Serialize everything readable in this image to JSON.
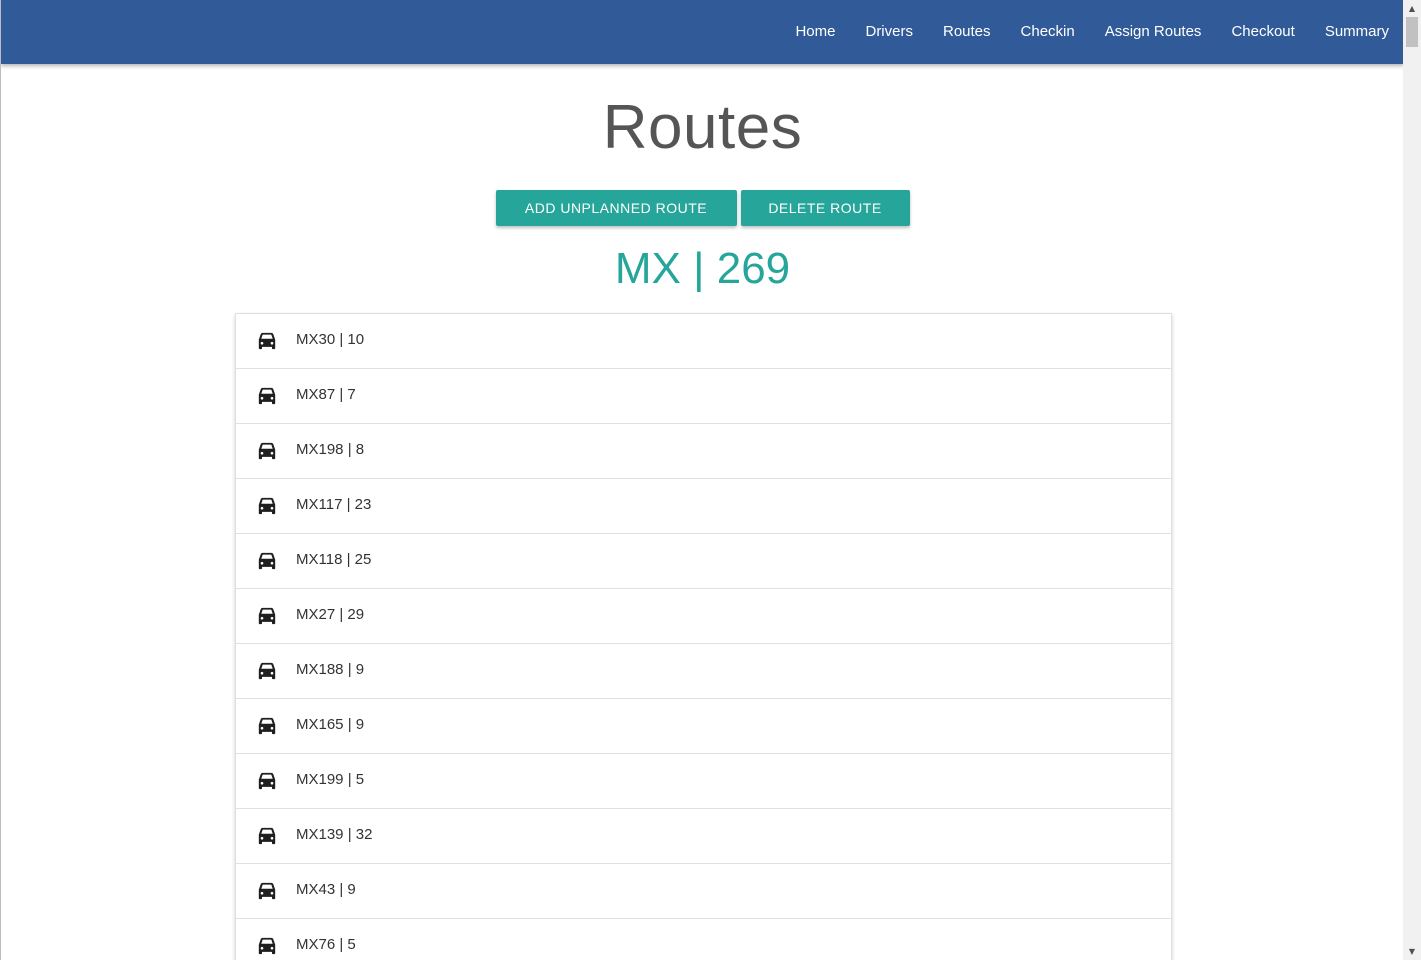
{
  "nav": {
    "items": [
      {
        "label": "Home"
      },
      {
        "label": "Drivers"
      },
      {
        "label": "Routes"
      },
      {
        "label": "Checkin"
      },
      {
        "label": "Assign Routes"
      },
      {
        "label": "Checkout"
      },
      {
        "label": "Summary"
      }
    ]
  },
  "page": {
    "title": "Routes",
    "summary": "MX | 269"
  },
  "actions": {
    "add_label": "ADD UNPLANNED ROUTE",
    "delete_label": "DELETE ROUTE"
  },
  "routes": [
    {
      "label": "MX30 | 10",
      "icon": "car-icon"
    },
    {
      "label": "MX87 | 7",
      "icon": "car-icon"
    },
    {
      "label": "MX198 | 8",
      "icon": "car-icon"
    },
    {
      "label": "MX117 | 23",
      "icon": "car-icon"
    },
    {
      "label": "MX118 | 25",
      "icon": "car-icon"
    },
    {
      "label": "MX27 | 29",
      "icon": "car-icon"
    },
    {
      "label": "MX188 | 9",
      "icon": "car-icon"
    },
    {
      "label": "MX165 | 9",
      "icon": "car-icon"
    },
    {
      "label": "MX199 | 5",
      "icon": "car-icon"
    },
    {
      "label": "MX139 | 32",
      "icon": "car-icon"
    },
    {
      "label": "MX43 | 9",
      "icon": "car-icon"
    },
    {
      "label": "MX76 | 5",
      "icon": "car-icon"
    }
  ],
  "colors": {
    "navbar": "#315a98",
    "accent": "#26a69a",
    "title": "#555555"
  }
}
